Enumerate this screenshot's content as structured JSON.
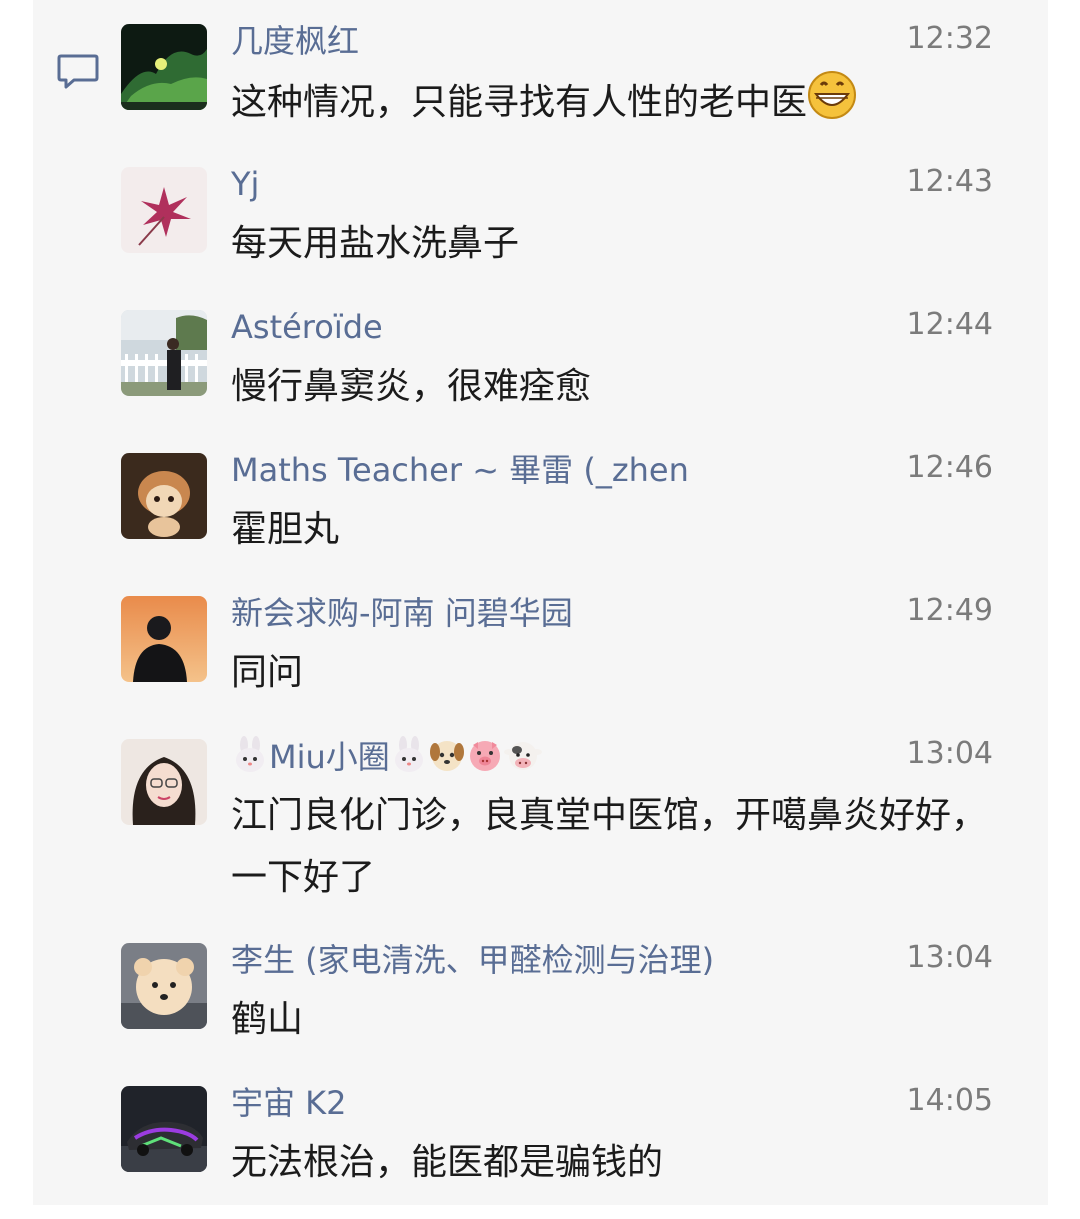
{
  "icons": {
    "comment": "comment-bubble-icon",
    "grin": "grinning-face-emoji",
    "rabbit": "rabbit-face-emoji",
    "dog": "dog-face-emoji",
    "pig": "pig-face-emoji",
    "cow": "cow-face-emoji"
  },
  "colors": {
    "panel": "#f6f6f6",
    "name": "#596d94",
    "time": "#7b7b7b",
    "text": "#1b1b1b"
  },
  "comments": [
    {
      "name": "几度枫红",
      "time": "12:32",
      "text": "这种情况，只能寻找有人性的老中医"
    },
    {
      "name": "Yj",
      "time": "12:43",
      "text": "每天用盐水洗鼻子"
    },
    {
      "name": "Astéroïde",
      "time": "12:44",
      "text": "慢行鼻窦炎，很难痊愈"
    },
    {
      "name": "Maths Teacher ~ 畢雷 (_zhen",
      "time": "12:46",
      "text": "霍胆丸"
    },
    {
      "name": "新会求购-阿南 问碧华园",
      "time": "12:49",
      "text": "同问"
    },
    {
      "name": "Miu小圈",
      "time": "13:04",
      "text": "江门良化门诊，良真堂中医馆，开噶鼻炎好好，一下好了"
    },
    {
      "name": "李生 (家电清洗、甲醛检测与治理)",
      "time": "13:04",
      "text": "鹤山"
    },
    {
      "name": "宇宙 K2",
      "time": "14:05",
      "text": "无法根治，能医都是骗钱的"
    }
  ]
}
